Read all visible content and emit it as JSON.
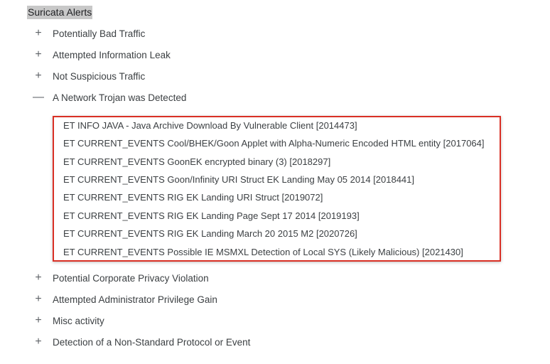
{
  "header": {
    "title": "Suricata Alerts"
  },
  "icons": {
    "expand": "plus-icon",
    "collapse": "minus-icon"
  },
  "categories_top": [
    {
      "toggle": "+",
      "label": "Potentially Bad Traffic"
    },
    {
      "toggle": "+",
      "label": "Attempted Information Leak"
    },
    {
      "toggle": "+",
      "label": "Not Suspicious Traffic"
    },
    {
      "toggle": "—",
      "label": "A Network Trojan was Detected"
    }
  ],
  "trojan_alerts": [
    "ET INFO JAVA - Java Archive Download By Vulnerable Client [2014473]",
    "ET CURRENT_EVENTS Cool/BHEK/Goon Applet with Alpha-Numeric Encoded HTML entity [2017064]",
    "ET CURRENT_EVENTS GoonEK encrypted binary (3) [2018297]",
    "ET CURRENT_EVENTS Goon/Infinity URI Struct EK Landing May 05 2014 [2018441]",
    "ET CURRENT_EVENTS RIG EK Landing URI Struct [2019072]",
    "ET CURRENT_EVENTS RIG EK Landing Page Sept 17 2014 [2019193]",
    "ET CURRENT_EVENTS RIG EK Landing March 20 2015 M2 [2020726]",
    "ET CURRENT_EVENTS Possible IE MSMXL Detection of Local SYS (Likely Malicious) [2021430]"
  ],
  "categories_bottom": [
    {
      "toggle": "+",
      "label": "Potential Corporate Privacy Violation"
    },
    {
      "toggle": "+",
      "label": "Attempted Administrator Privilege Gain"
    },
    {
      "toggle": "+",
      "label": "Misc activity"
    },
    {
      "toggle": "+",
      "label": "Detection of a Non-Standard Protocol or Event"
    }
  ],
  "highlight": {
    "border_color": "#d93025",
    "title_bg": "#c8c8c8"
  }
}
